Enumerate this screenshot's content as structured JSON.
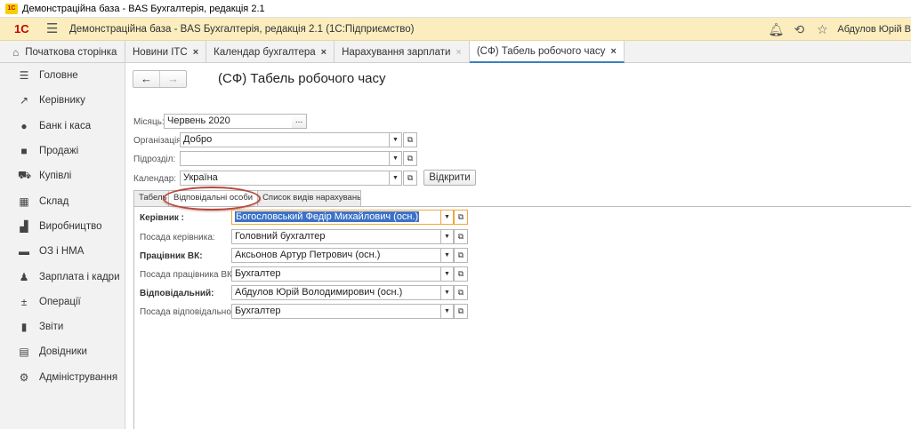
{
  "window": {
    "title": "Демонстраційна база - BAS Бухгалтерія, редакція 2.1"
  },
  "app": {
    "logo": "1С",
    "title": "Демонстраційна база - BAS Бухгалтерія, редакція 2.1  (1С:Підприємство)",
    "user": "Абдулов Юрій В",
    "icons": [
      "bell-icon",
      "history-icon",
      "star-icon"
    ]
  },
  "tabs": {
    "home": "Початкова сторінка",
    "items": [
      {
        "label": "Новини ІТС",
        "close": "×"
      },
      {
        "label": "Календар бухгалтера",
        "close": "×"
      },
      {
        "label": "Нарахування зарплати",
        "close": "×"
      },
      {
        "label": "(СФ) Табель робочого часу",
        "close": "×"
      }
    ]
  },
  "sidebar": {
    "items": [
      {
        "label": "Головне",
        "icon": "menu-icon"
      },
      {
        "label": "Керівнику",
        "icon": "trend-icon"
      },
      {
        "label": "Банк і каса",
        "icon": "coin-icon"
      },
      {
        "label": "Продажі",
        "icon": "bag-icon"
      },
      {
        "label": "Купівлі",
        "icon": "cart-icon"
      },
      {
        "label": "Склад",
        "icon": "warehouse-icon"
      },
      {
        "label": "Виробництво",
        "icon": "factory-icon"
      },
      {
        "label": "ОЗ і НМА",
        "icon": "truck-icon"
      },
      {
        "label": "Зарплата і кадри",
        "icon": "person-icon"
      },
      {
        "label": "Операції",
        "icon": "operations-icon"
      },
      {
        "label": "Звіти",
        "icon": "chart-icon"
      },
      {
        "label": "Довідники",
        "icon": "books-icon"
      },
      {
        "label": "Адміністрування",
        "icon": "gear-icon"
      }
    ]
  },
  "form": {
    "title": "(СФ) Табель робочого часу",
    "nav_back": "←",
    "nav_forward": "→",
    "month_label": "Місяць:",
    "month_value": "Червень 2020",
    "org_label": "Організація:",
    "org_value": "Добро",
    "dept_label": "Підрозділ:",
    "dept_value": "",
    "calendar_label": "Календар:",
    "calendar_value": "Україна",
    "open_button": "Відкрити",
    "tabs": [
      "Табель",
      "Відповідальні особи",
      "Список видів нарахувань"
    ],
    "responsible": {
      "head_label": "Керівник :",
      "head_value": "Богословський Федір Михайлович (осн.)",
      "head_pos_label": "Посада керівника:",
      "head_pos_value": "Головний бухгалтер",
      "hr_label": "Працівник ВК:",
      "hr_value": "Аксьонов Артур Петрович (осн.)",
      "hr_pos_label": "Посада працівника ВК:",
      "hr_pos_value": "Бухгалтер",
      "resp_label": "Відповідальний:",
      "resp_value": "Абдулов Юрій Володимирович (осн.)",
      "resp_pos_label": "Посада відповідального:",
      "resp_pos_value": "Бухгалтер"
    }
  },
  "colors": {
    "header_bg": "#fbedbe",
    "active_tab_underline": "#3b7fc0",
    "selection": "#3c72c7",
    "focus": "#f0a640",
    "annotation": "#b9473e"
  }
}
